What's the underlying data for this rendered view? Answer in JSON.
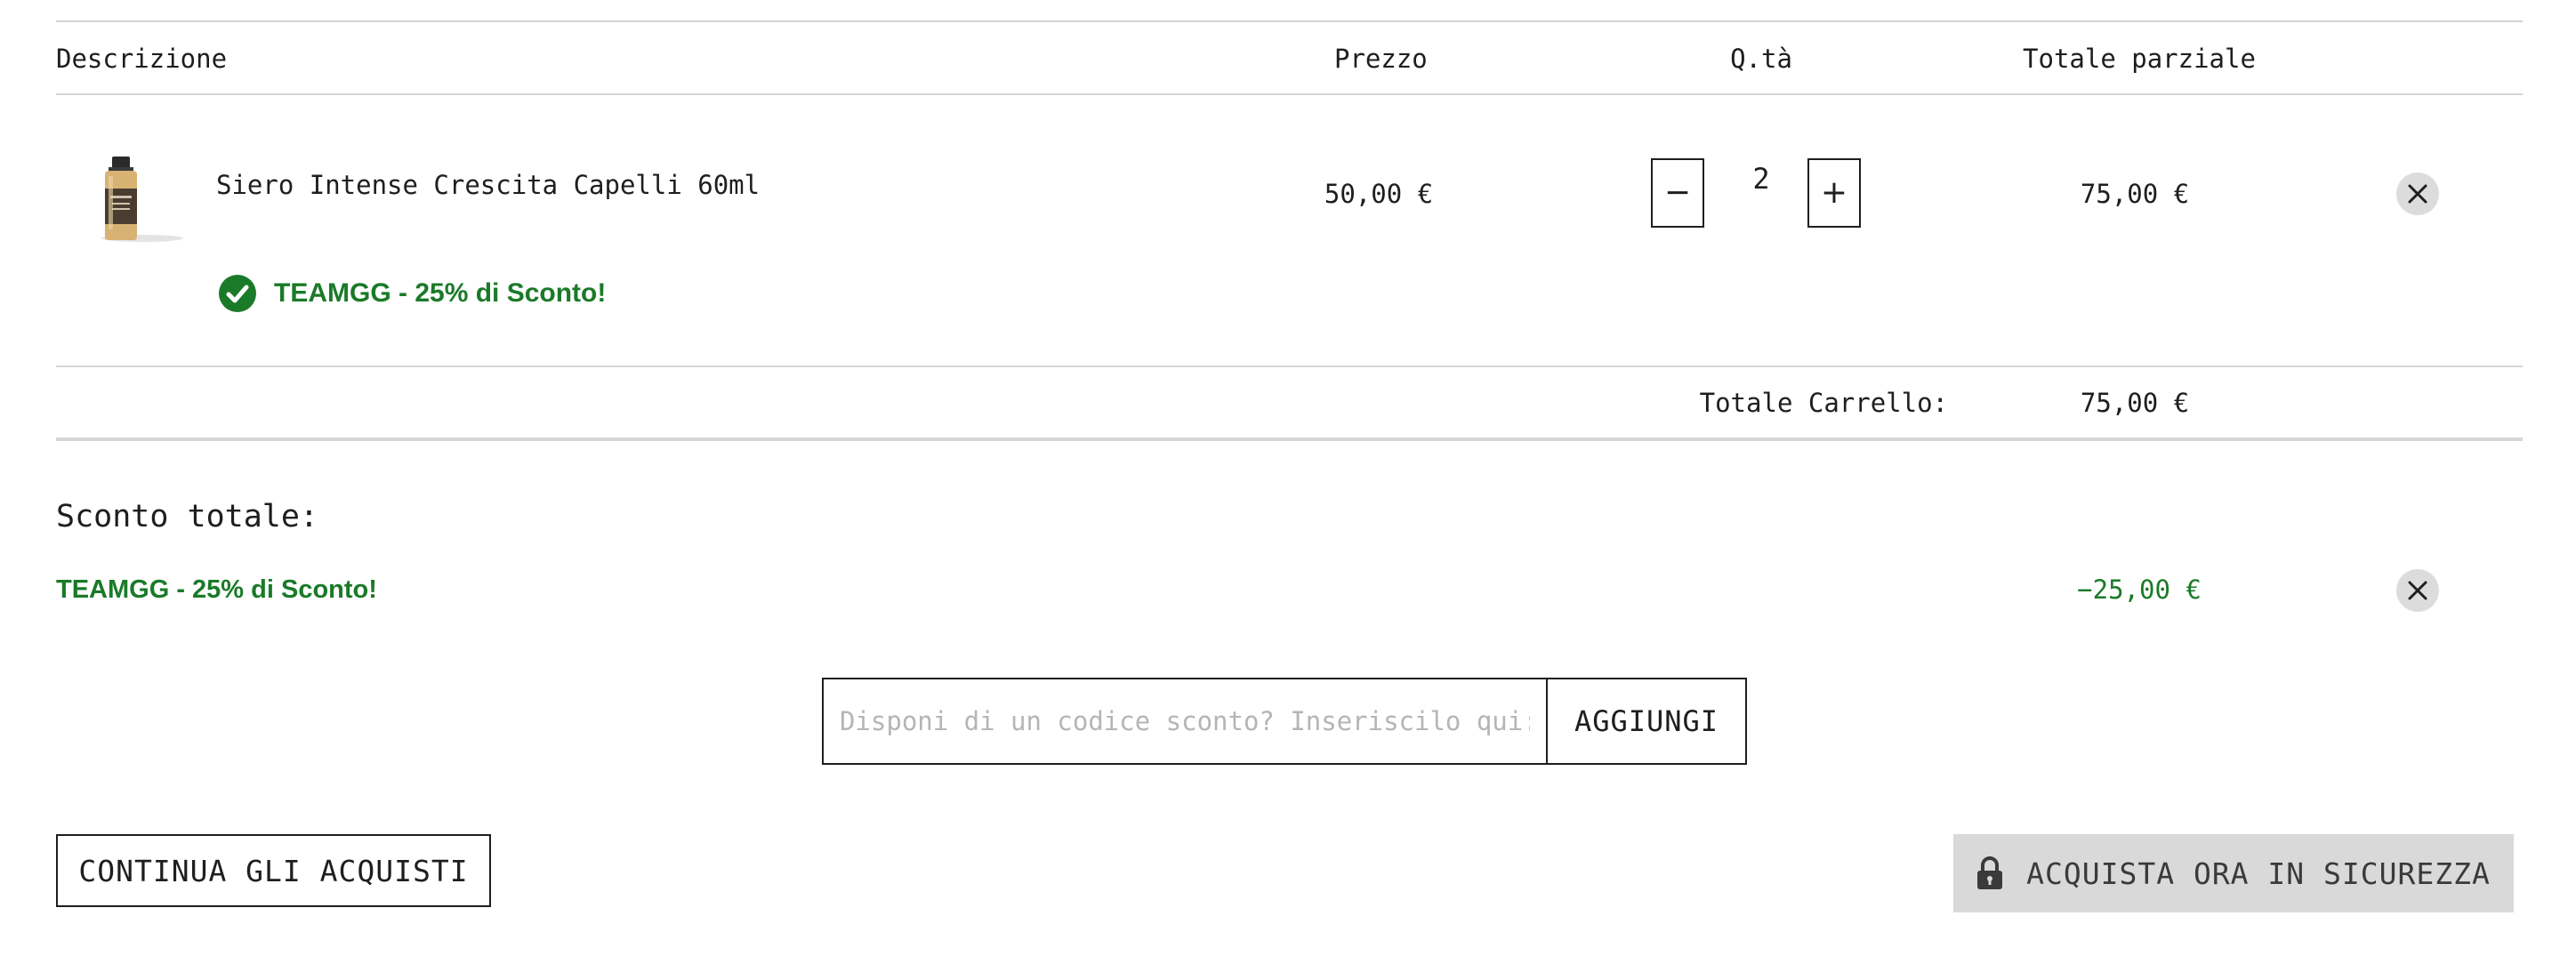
{
  "table": {
    "headers": {
      "description": "Descrizione",
      "price": "Prezzo",
      "quantity": "Q.tà",
      "subtotal": "Totale parziale"
    },
    "items": [
      {
        "name": "Siero Intense Crescita Capelli 60ml",
        "price": "50,00 €",
        "quantity": "2",
        "subtotal": "75,00 €",
        "discount_badge": "TEAMGG - 25% di Sconto!"
      }
    ],
    "quantity_minus": "−",
    "quantity_plus": "+"
  },
  "cart_total": {
    "label": "Totale Carrello:",
    "value": "75,00 €"
  },
  "discount_summary": {
    "title": "Sconto totale:",
    "code_label": "TEAMGG - 25% di Sconto!",
    "amount": "−25,00 €"
  },
  "coupon": {
    "placeholder": "Disponi di un codice sconto? Inseriscilo qui:",
    "button": "AGGIUNGI"
  },
  "actions": {
    "continue": "CONTINUA GLI ACQUISTI",
    "checkout": "ACQUISTA ORA IN SICUREZZA"
  },
  "icons": {
    "check": "check-circle-icon",
    "remove": "close-icon",
    "lock": "lock-icon"
  },
  "colors": {
    "discount_green": "#1a7a28",
    "text": "#1e1e1e",
    "checkout_bg": "#d9d9d9",
    "remove_bg": "#dcdcdc",
    "placeholder": "#b5b5b5"
  }
}
